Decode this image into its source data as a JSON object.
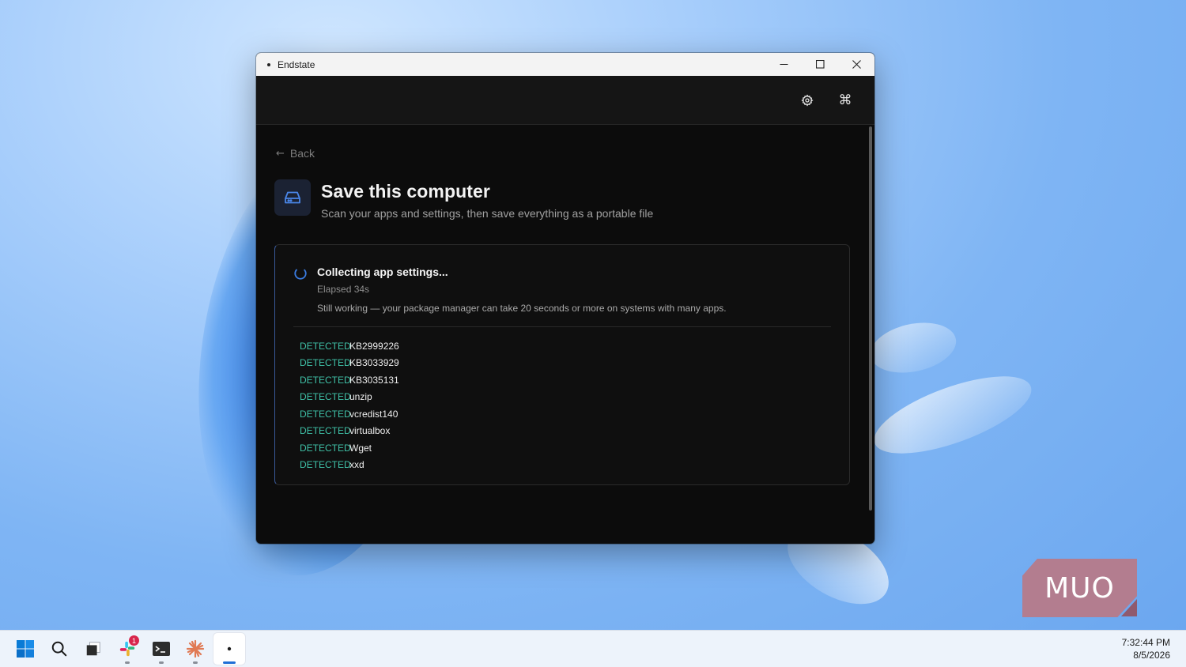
{
  "window": {
    "title": "Endstate",
    "controls": {
      "minimize_icon": "minimize-icon",
      "maximize_icon": "maximize-icon",
      "close_icon": "close-icon"
    }
  },
  "toolbar": {
    "settings_icon": "gear-icon",
    "command_icon": "command-icon",
    "command_glyph": "⌘"
  },
  "nav": {
    "back_label": "Back",
    "back_glyph": "←"
  },
  "header": {
    "icon": "drive-icon",
    "title": "Save this computer",
    "subtitle": "Scan your apps and settings, then save everything as a portable file"
  },
  "status": {
    "title": "Collecting app settings...",
    "elapsed": "Elapsed 34s",
    "note": "Still working — your package manager can take 20 seconds or more on systems with many apps."
  },
  "log": [
    {
      "tag": "DETECTED",
      "name": "KB2999226"
    },
    {
      "tag": "DETECTED",
      "name": "KB3033929"
    },
    {
      "tag": "DETECTED",
      "name": "KB3035131"
    },
    {
      "tag": "DETECTED",
      "name": "unzip"
    },
    {
      "tag": "DETECTED",
      "name": "vcredist140"
    },
    {
      "tag": "DETECTED",
      "name": "virtualbox"
    },
    {
      "tag": "DETECTED",
      "name": "Wget"
    },
    {
      "tag": "DETECTED",
      "name": "xxd"
    }
  ],
  "watermark": {
    "text": "MUO"
  },
  "taskbar": {
    "icons": [
      "windows-start-icon",
      "search-icon",
      "task-view-icon",
      "slack-icon",
      "terminal-icon",
      "claude-icon",
      "endstate-app-icon"
    ],
    "slack_badge": "1",
    "time": "7:32:44 PM",
    "date": "8/5/2026"
  },
  "colors": {
    "accent": "#3a7be0",
    "detected": "#3fc1a7",
    "window_bg": "#0c0c0c"
  }
}
